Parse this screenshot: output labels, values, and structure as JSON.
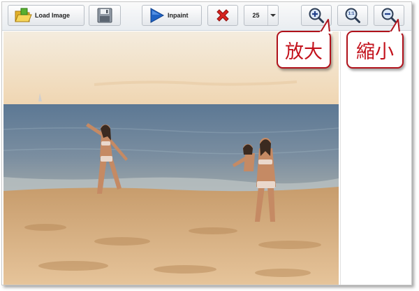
{
  "toolbar": {
    "load_image_label": "Load Image",
    "inpaint_label": "Inpaint",
    "brush_size_value": "25",
    "zoom_actual_label": "1:1"
  },
  "callouts": {
    "zoom_in_label": "放大",
    "zoom_out_label": "縮小"
  },
  "colors": {
    "callout_border": "#b0121b",
    "callout_text": "#c3121c",
    "delete_red": "#d8231f",
    "play_blue": "#1f63c4"
  },
  "icons": [
    "folder-icon",
    "save-icon",
    "play-icon",
    "delete-icon",
    "dropdown-arrow-icon",
    "zoom-in-icon",
    "zoom-actual-icon",
    "zoom-out-icon"
  ]
}
